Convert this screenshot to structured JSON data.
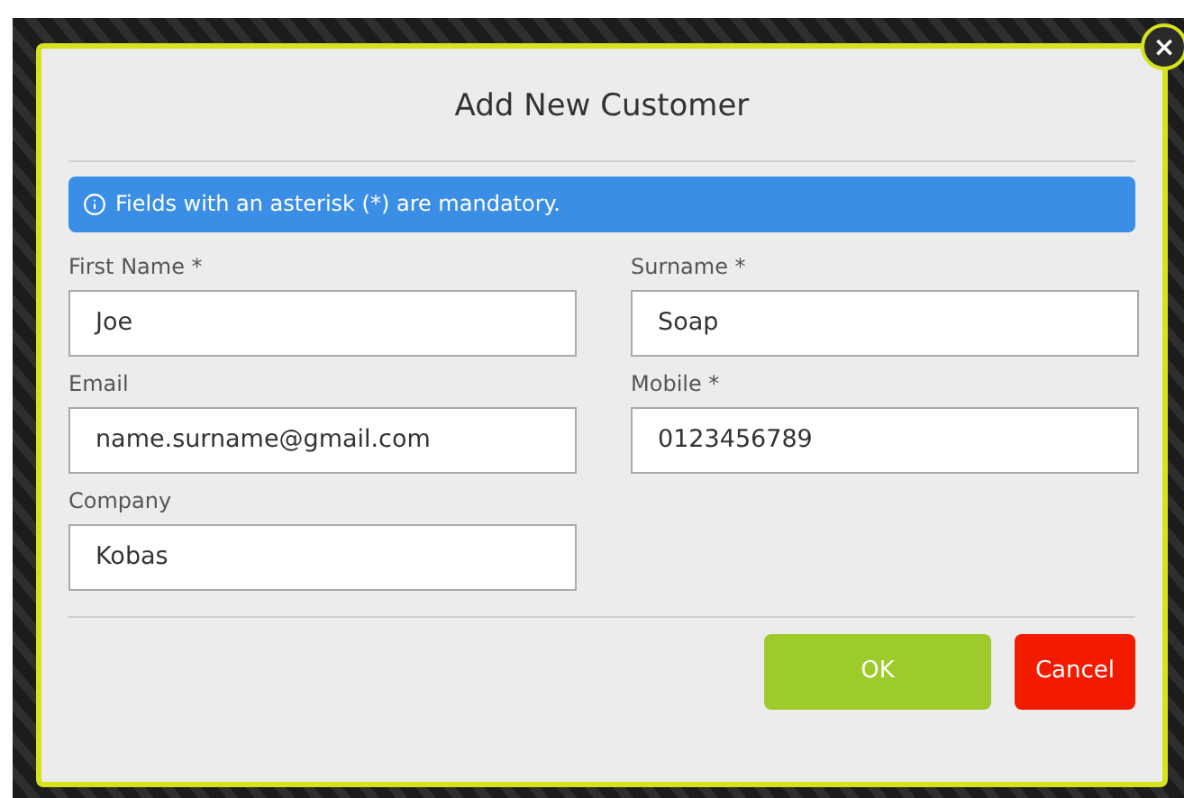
{
  "dialog": {
    "title": "Add New Customer",
    "close_icon": "×",
    "notice": "Fields with an asterisk (*) are mandatory.",
    "fields": [
      {
        "label": "First Name *",
        "value": "Joe"
      },
      {
        "label": "Surname *",
        "value": "Soap"
      },
      {
        "label": "Email",
        "value": "name.surname@gmail.com"
      },
      {
        "label": "Mobile *",
        "value": "0123456789"
      },
      {
        "label": "Company",
        "value": "Kobas"
      }
    ],
    "buttons": [
      {
        "label": "OK",
        "kind": "primary"
      },
      {
        "label": "Cancel",
        "kind": "danger"
      }
    ]
  }
}
